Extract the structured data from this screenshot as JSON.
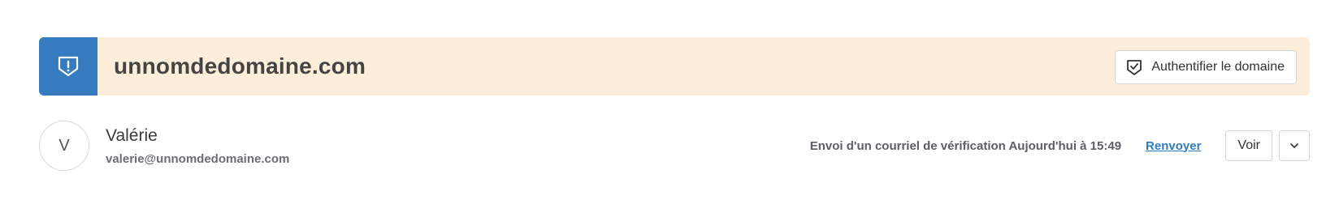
{
  "banner": {
    "icon": "shield-exclamation-icon",
    "domain": "unnomdedomaine.com",
    "auth_button": {
      "icon": "shield-check-icon",
      "label": "Authentifier le domaine"
    }
  },
  "user": {
    "avatar_initial": "V",
    "name": "Valérie",
    "email": "valerie@unnomdedomaine.com",
    "status": "Envoi d'un courriel de vérification Aujourd'hui à 15:49",
    "resend_label": "Renvoyer",
    "view_label": "Voir",
    "more_icon": "chevron-down-icon"
  },
  "colors": {
    "banner_bg": "#fdeedb",
    "icon_box": "#347bbf",
    "link": "#2f7bc2"
  }
}
